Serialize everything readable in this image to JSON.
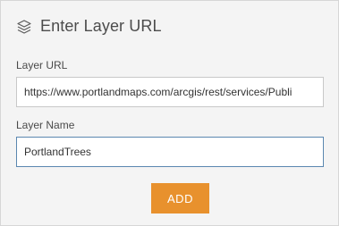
{
  "header": {
    "icon": "layers-icon",
    "title": "Enter Layer URL"
  },
  "form": {
    "url_label": "Layer URL",
    "url_value": "https://www.portlandmaps.com/arcgis/rest/services/Publi",
    "name_label": "Layer Name",
    "name_value": "PortlandTrees",
    "add_label": "ADD"
  },
  "colors": {
    "accent_button": "#e8912d",
    "focus_border": "#5b87b0",
    "panel_background": "#f4f4f4"
  }
}
